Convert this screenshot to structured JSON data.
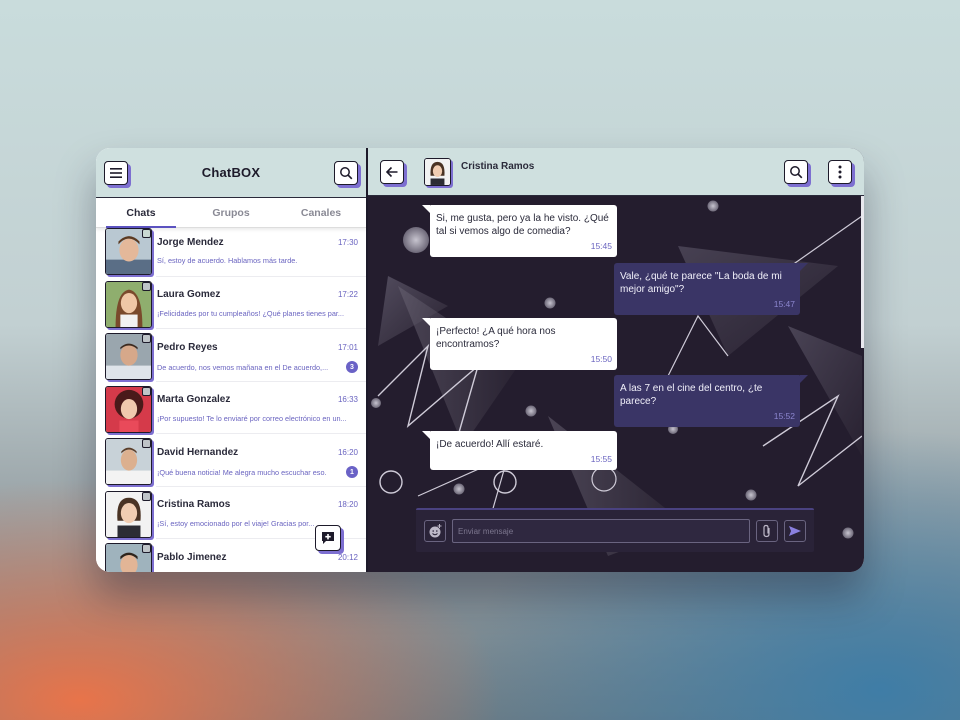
{
  "sidebar": {
    "title": "ChatBOX",
    "icons": {
      "menu": "hamburger-menu-icon",
      "search": "search-icon",
      "new_chat": "new-message-icon"
    },
    "tabs": [
      {
        "label": "Chats",
        "active": true
      },
      {
        "label": "Grupos",
        "active": false
      },
      {
        "label": "Canales",
        "active": false
      }
    ],
    "chats": [
      {
        "name": "Jorge Mendez",
        "time": "17:30",
        "preview": "Sí, estoy de acuerdo. Hablamos más tarde.",
        "badge": ""
      },
      {
        "name": "Laura Gomez",
        "time": "17:22",
        "preview": "¡Felicidades por tu cumpleaños! ¿Qué planes tienes par...",
        "badge": ""
      },
      {
        "name": "Pedro Reyes",
        "time": "17:01",
        "preview": "De acuerdo, nos vemos mañana en el De acuerdo,...",
        "badge": "3"
      },
      {
        "name": "Marta Gonzalez",
        "time": "16:33",
        "preview": "¡Por supuesto! Te lo enviaré por correo electrónico en un...",
        "badge": ""
      },
      {
        "name": "David Hernandez",
        "time": "16:20",
        "preview": "¡Qué buena noticia! Me alegra mucho escuchar eso.",
        "badge": "1"
      },
      {
        "name": "Cristina Ramos",
        "time": "18:20",
        "preview": "¡Sí, estoy emocionado por el viaje! Gracias por...",
        "badge": ""
      },
      {
        "name": "Pablo Jimenez",
        "time": "20:12",
        "preview": "",
        "badge": ""
      }
    ]
  },
  "conversation": {
    "contact_name": "Cristina Ramos",
    "icons": {
      "back": "back-arrow-icon",
      "search": "search-icon",
      "more": "more-vertical-icon"
    },
    "messages": [
      {
        "direction": "in",
        "text": "Si, me gusta, pero ya la he visto. ¿Qué tal si vemos algo de comedia?",
        "time": "15:45"
      },
      {
        "direction": "out",
        "text": "Vale, ¿qué te parece \"La boda de mi mejor amigo\"?",
        "time": "15:47"
      },
      {
        "direction": "in",
        "text": "¡Perfecto! ¿A qué hora nos encontramos?",
        "time": "15:50"
      },
      {
        "direction": "out",
        "text": "A las 7 en el cine del centro, ¿te parece?",
        "time": "15:52"
      },
      {
        "direction": "in",
        "text": "¡De acuerdo! Allí estaré.",
        "time": "15:55"
      }
    ],
    "composer": {
      "placeholder": "Enviar mensaje",
      "icons": {
        "emoji": "emoji-add-icon",
        "attach": "attach-icon",
        "send": "send-icon"
      }
    }
  },
  "colors": {
    "accent": "#7d6fd1",
    "header_bg": "#cfe0df",
    "chat_bg": "#241d2e",
    "outgoing_bubble": "#3a3566"
  }
}
